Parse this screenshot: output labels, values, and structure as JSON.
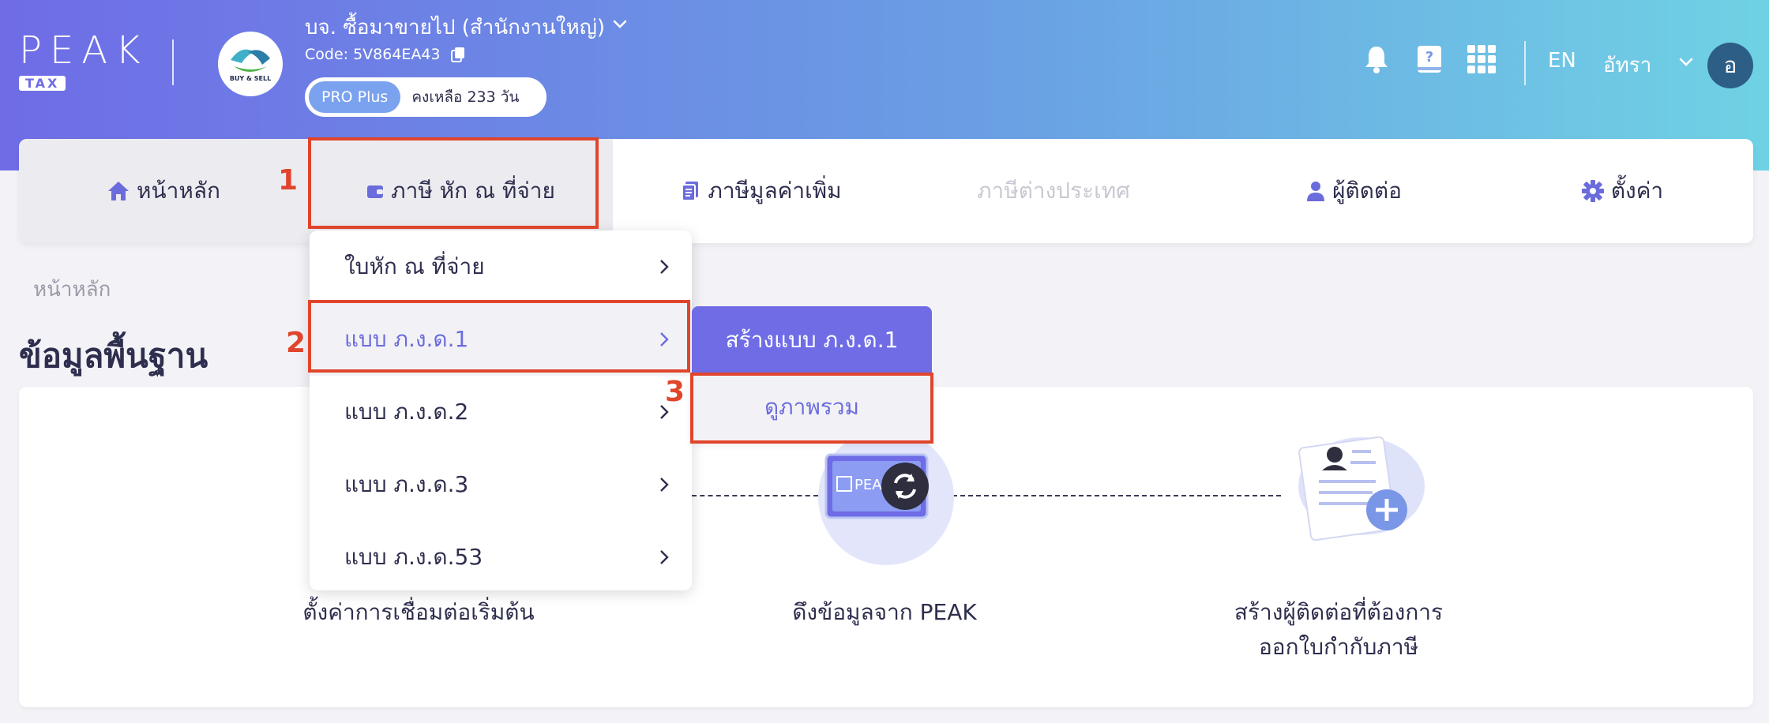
{
  "header": {
    "logo_word": "PEAK",
    "logo_sub": "TAX",
    "company_name": "บจ. ซื้อมาขายไป (สำนักงานใหญ่)",
    "company_code": "Code: 5V864EA43",
    "plan_badge": "PRO Plus",
    "plan_days": "คงเหลือ 233 วัน",
    "language": "EN",
    "user_name": "อัทรา",
    "avatar_initial": "อ",
    "company_logo_text": "BUY & SELL"
  },
  "nav": {
    "home": "หน้าหลัก",
    "withholding": "ภาษี หัก ณ ที่จ่าย",
    "vat": "ภาษีมูลค่าเพิ่ม",
    "foreign": "ภาษีต่างประเทศ",
    "contacts": "ผู้ติดต่อ",
    "settings": "ตั้งค่า"
  },
  "breadcrumb": "หน้าหลัก",
  "page_title": "ข้อมูลพื้นฐาน",
  "steps": {
    "step1": "ตั้งค่าการเชื่อมต่อเริ่มต้น",
    "step2": "ดึงข้อมูลจาก PEAK",
    "step3_line1": "สร้างผู้ติดต่อที่ต้องการ",
    "step3_line2": "ออกใบกำกับภาษี",
    "screen_text": "PEAK"
  },
  "dropdown": {
    "items": [
      {
        "label": "ใบหัก ณ ที่จ่าย"
      },
      {
        "label": "แบบ ภ.ง.ด.1"
      },
      {
        "label": "แบบ ภ.ง.ด.2"
      },
      {
        "label": "แบบ ภ.ง.ด.3"
      },
      {
        "label": "แบบ ภ.ง.ด.53"
      }
    ]
  },
  "submenu": {
    "create": "สร้างแบบ ภ.ง.ด.1",
    "overview": "ดูภาพรวม"
  },
  "annotations": {
    "n1": "1",
    "n2": "2",
    "n3": "3"
  },
  "colors": {
    "accent": "#6f6ce6",
    "highlight": "#e0452c",
    "avatar": "#2d5f86"
  }
}
